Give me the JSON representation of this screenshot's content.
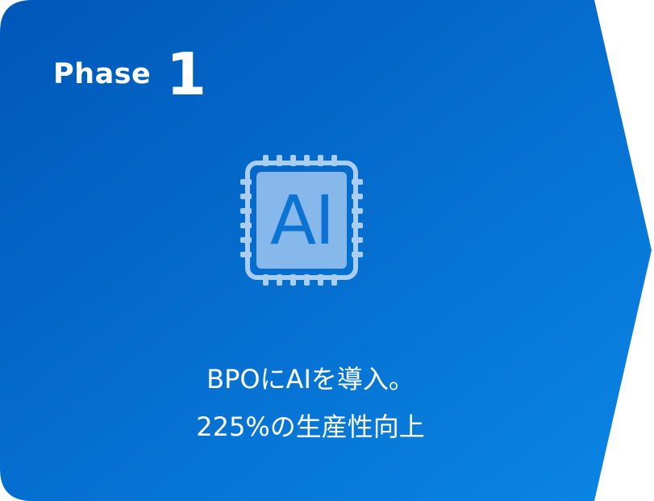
{
  "phase": {
    "label": "Phase",
    "number": "1"
  },
  "icon": {
    "name": "ai-chip-icon",
    "text": "AI"
  },
  "description": {
    "line1": "BPOにAIを導入。",
    "line2": "225%の生産性向上"
  },
  "colors": {
    "gradient_start": "#0057b8",
    "gradient_end": "#0a86e6",
    "chip_fill": "#86b8ec",
    "chip_border": "#a9cdf3",
    "text": "#ffffff"
  }
}
